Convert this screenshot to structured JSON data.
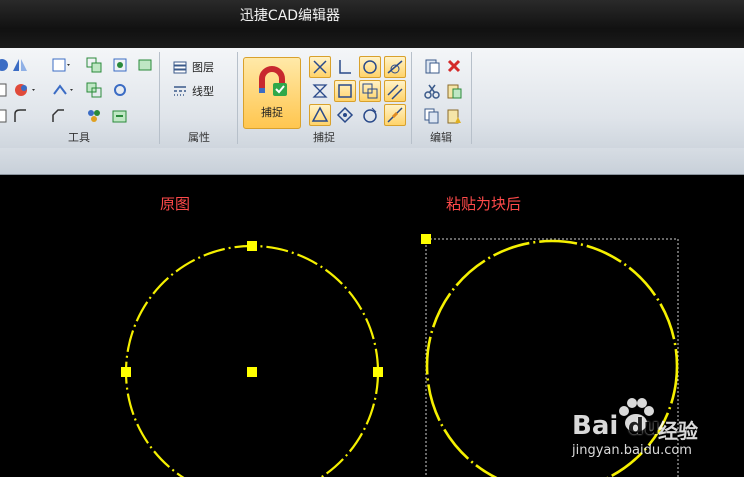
{
  "app": {
    "title": "迅捷CAD编辑器"
  },
  "ribbon": {
    "groups": {
      "tools": {
        "label": "工具"
      },
      "properties": {
        "label": "属性",
        "layer_label": "图层",
        "linetype_label": "线型"
      },
      "snap": {
        "label": "捕捉",
        "snap_button_label": "捕捉"
      },
      "edit": {
        "label": "编辑"
      }
    }
  },
  "canvas": {
    "original_label": "原图",
    "pasted_label": "粘贴为块后",
    "line_color": "#f5f000",
    "grip_color": "#ffff00",
    "label_color": "#ff4a4a"
  },
  "watermark": {
    "brand": "Bai",
    "brand_suffix": "du",
    "cn": "经验",
    "url": "jingyan.baidu.com"
  }
}
